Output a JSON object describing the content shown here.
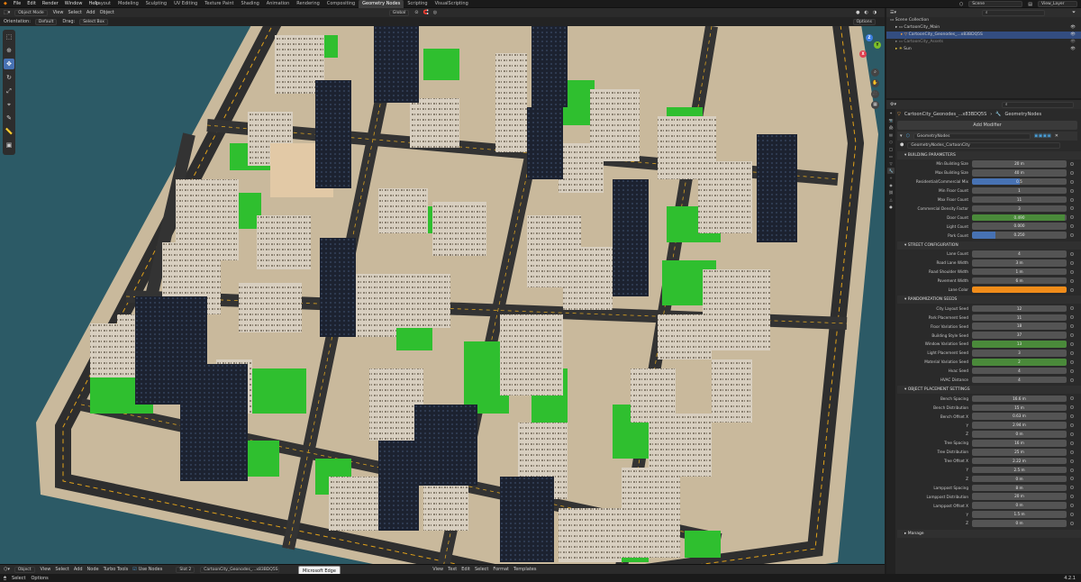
{
  "menu": [
    "File",
    "Edit",
    "Render",
    "Window",
    "Help"
  ],
  "workspaces": [
    "Layout",
    "Modeling",
    "Sculpting",
    "UV Editing",
    "Texture Paint",
    "Shading",
    "Animation",
    "Rendering",
    "Compositing",
    "Geometry Nodes",
    "Scripting",
    "VisualScripting"
  ],
  "active_workspace": "Geometry Nodes",
  "scene_name": "Scene",
  "view_layer": "View_Layer",
  "viewport": {
    "mode": "Object Mode",
    "menus": [
      "View",
      "Select",
      "Add",
      "Object"
    ],
    "transform": "Global",
    "orientation_label": "Orientation:",
    "orientation_value": "Default",
    "drag_label": "Drag:",
    "drag_value": "Select Box",
    "options": "Options",
    "background_color": "#2c5a66"
  },
  "outliner": {
    "search_placeholder": "",
    "root": "Scene Collection",
    "items": [
      {
        "name": "CartoonCity_Main"
      },
      {
        "name": "CartoonCity_Geonodes_...x83BDQ5S"
      },
      {
        "name": "CartoonCity_Assets"
      },
      {
        "name": "Sun"
      }
    ]
  },
  "properties": {
    "object_name": "CartoonCity_Geonodes_...x83BDQ5S",
    "modifier_tab": "GeometryNodes",
    "add_modifier": "Add Modifier",
    "modifier_name": "GeometryNodes",
    "node_group": "GeometryNodes_CartoonCity",
    "sections": [
      {
        "title": "BUILDING PARAMETERS",
        "params": [
          {
            "label": "Min Building Size",
            "value": "20 m"
          },
          {
            "label": "Max Building Size",
            "value": "40 m"
          },
          {
            "label": "Residential/Commercial Mix",
            "value": "0.5",
            "fill": 0.5,
            "fill_color": "#4772b3"
          },
          {
            "label": "Min Floor Count",
            "value": "1"
          },
          {
            "label": "Max Floor Count",
            "value": "11"
          },
          {
            "label": "Commercial Density Factor",
            "value": "3"
          },
          {
            "label": "Door Count",
            "value": "0.490",
            "fill": 0.98,
            "fill_color": "#4a8a3a"
          },
          {
            "label": "Light Count",
            "value": "0.000"
          },
          {
            "label": "Park Count",
            "value": "0.250",
            "fill": 0.25,
            "fill_color": "#4772b3"
          }
        ]
      },
      {
        "title": "STREET CONFIGURATION",
        "params": [
          {
            "label": "Lane Count",
            "value": "4"
          },
          {
            "label": "Road Lane Width",
            "value": "3 m"
          },
          {
            "label": "Road Shoulder Width",
            "value": "1 m"
          },
          {
            "label": "Pavement Width",
            "value": "6 m"
          },
          {
            "label": "Lane Color",
            "value": "",
            "fill": 1,
            "fill_color": "#f08c1a"
          }
        ]
      },
      {
        "title": "RANDOMIZATION SEEDS",
        "params": [
          {
            "label": "City Layout Seed",
            "value": "12"
          },
          {
            "label": "Park Placement Seed",
            "value": "11"
          },
          {
            "label": "Floor Variation Seed",
            "value": "18"
          },
          {
            "label": "Building Style Seed",
            "value": "37"
          },
          {
            "label": "Window Variation Seed",
            "value": "13",
            "fill": 1,
            "fill_color": "#4a8a3a"
          },
          {
            "label": "Light Placement Seed",
            "value": "3"
          },
          {
            "label": "Material Variation Seed",
            "value": "2",
            "fill": 1,
            "fill_color": "#4a8a3a"
          },
          {
            "label": "Hvac Seed",
            "value": "4"
          },
          {
            "label": "HVAC Distance",
            "value": "4"
          }
        ]
      },
      {
        "title": "OBJECT PLACEMENT SETTINGS",
        "params": [
          {
            "label": "Bench Spacing",
            "value": "16.6 m"
          },
          {
            "label": "Bench Distribution",
            "value": "15 m"
          },
          {
            "label": "Bench Offset X",
            "value": "0.63 m"
          },
          {
            "label": "Y",
            "value": "2.94 m"
          },
          {
            "label": "Z",
            "value": "0 m"
          },
          {
            "label": "Tree Spacing",
            "value": "16 m"
          },
          {
            "label": "Tree Distribution",
            "value": "25 m"
          },
          {
            "label": "Tree Offset X",
            "value": "2.22 m"
          },
          {
            "label": "Y",
            "value": "2.5 m"
          },
          {
            "label": "Z",
            "value": "0 m"
          },
          {
            "label": "Lamppost Spacing",
            "value": "8 m"
          },
          {
            "label": "Lamppost Distribution",
            "value": "20 m"
          },
          {
            "label": "Lamppost Offset X",
            "value": "0 m"
          },
          {
            "label": "Y",
            "value": "1.5 m"
          },
          {
            "label": "Z",
            "value": "0 m"
          }
        ]
      }
    ],
    "manage": "Manage"
  },
  "node_editor": {
    "type": "Object",
    "menus": [
      "View",
      "Select",
      "Add",
      "Node",
      "Turbo Tools"
    ],
    "use_nodes": "Use Nodes",
    "slot": "Slot 2",
    "object": "CartoonCity_Geonodes_...x83BDQ5S",
    "tooltip": "Microsoft Edge",
    "text_menus": [
      "View",
      "Text",
      "Edit",
      "Select",
      "Format",
      "Templates"
    ]
  },
  "status": {
    "left": "Select",
    "right_item": "Options",
    "version": "4.2.1"
  }
}
